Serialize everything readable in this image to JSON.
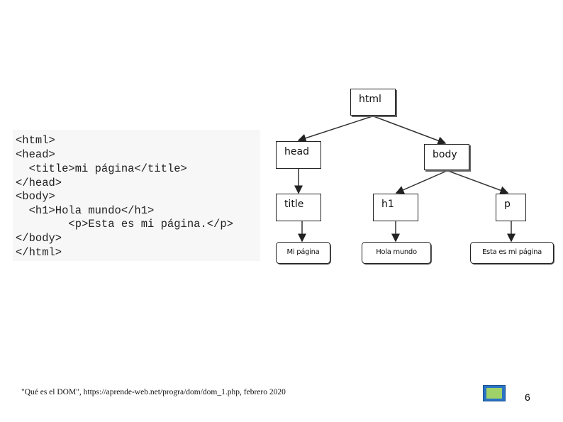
{
  "code_lines": [
    "<html>",
    "<head>",
    "  <title>mi página</title>",
    "</head>",
    "<body>",
    "  <h1>Hola mundo</h1>",
    "        <p>Esta es mi página.</p>",
    "</body>",
    "</html>"
  ],
  "tree": {
    "html": "html",
    "head": "head",
    "body": "body",
    "title": "title",
    "h1": "h1",
    "p": "p",
    "leaf_title": "Mi página",
    "leaf_h1": "Hola mundo",
    "leaf_p": "Esta es mi página"
  },
  "footer": {
    "citation": "\"Qué es el DOM\", https://aprende-web.net/progra/dom/dom_1.php, febrero 2020",
    "page_number": "6",
    "logo_icon": "presentation-logo-icon"
  }
}
